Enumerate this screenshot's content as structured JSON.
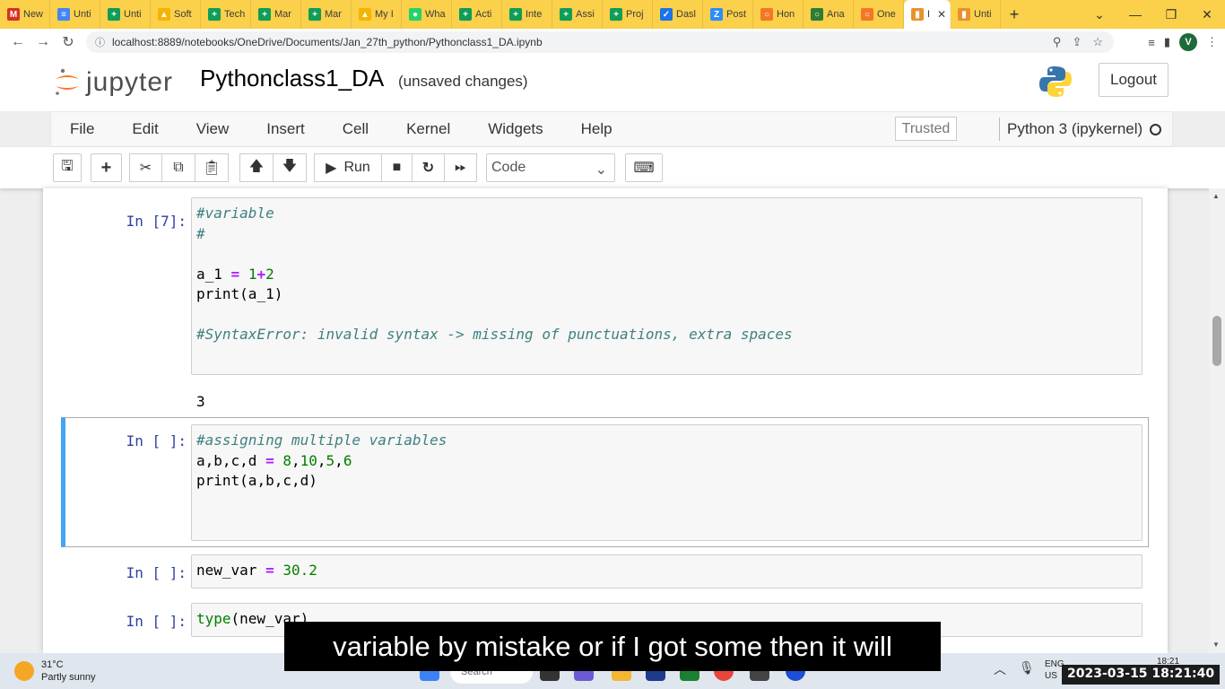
{
  "browser": {
    "tabs": [
      {
        "label": "New",
        "color": "#d93025",
        "glyph": "M"
      },
      {
        "label": "Unti",
        "color": "#4285f4",
        "glyph": "≡"
      },
      {
        "label": "Unti",
        "color": "#0f9d58",
        "glyph": "+"
      },
      {
        "label": "Soft",
        "color": "#f4b400",
        "glyph": "▲"
      },
      {
        "label": "Tech",
        "color": "#0f9d58",
        "glyph": "+"
      },
      {
        "label": "Mar",
        "color": "#0f9d58",
        "glyph": "+"
      },
      {
        "label": "Mar",
        "color": "#0f9d58",
        "glyph": "+"
      },
      {
        "label": "My I",
        "color": "#f4b400",
        "glyph": "▲"
      },
      {
        "label": "Wha",
        "color": "#25d366",
        "glyph": "●"
      },
      {
        "label": "Acti",
        "color": "#0f9d58",
        "glyph": "+"
      },
      {
        "label": "Inte",
        "color": "#0f9d58",
        "glyph": "+"
      },
      {
        "label": "Assi",
        "color": "#0f9d58",
        "glyph": "+"
      },
      {
        "label": "Proj",
        "color": "#0f9d58",
        "glyph": "+"
      },
      {
        "label": "Dasl",
        "color": "#1a73e8",
        "glyph": "✓"
      },
      {
        "label": "Post",
        "color": "#2d8cff",
        "glyph": "Z"
      },
      {
        "label": "Hon",
        "color": "#f37726",
        "glyph": "○"
      },
      {
        "label": "Ana",
        "color": "#2e7d32",
        "glyph": "○"
      },
      {
        "label": "One",
        "color": "#f37726",
        "glyph": "○"
      },
      {
        "label": "I",
        "color": "#e8912d",
        "glyph": "▮",
        "active": true
      },
      {
        "label": "Unti",
        "color": "#e8912d",
        "glyph": "▮"
      }
    ],
    "new_tab": "+",
    "window_controls": [
      "⌄",
      "—",
      "❐",
      "✕"
    ],
    "url": "localhost:8889/notebooks/OneDrive/Documents/Jan_27th_python/Pythonclass1_DA.ipynb",
    "avatar_letter": "V"
  },
  "jupyter": {
    "logo_text": "jupyter",
    "notebook_title": "Pythonclass1_DA",
    "save_status": "(unsaved changes)",
    "logout_label": "Logout",
    "menu": [
      "File",
      "Edit",
      "View",
      "Insert",
      "Cell",
      "Kernel",
      "Widgets",
      "Help"
    ],
    "trusted_label": "Trusted",
    "kernel_name": "Python 3 (ipykernel)",
    "toolbar": {
      "run_label": "Run",
      "cell_type": "Code"
    }
  },
  "cells": [
    {
      "prompt": "In [7]:",
      "lines": [
        [
          {
            "t": "#variable",
            "c": "comment"
          }
        ],
        [
          {
            "t": "#",
            "c": "comment"
          }
        ],
        [
          {
            "t": "",
            "c": ""
          }
        ],
        [
          {
            "t": "a_1 ",
            "c": ""
          },
          {
            "t": "=",
            "c": "op"
          },
          {
            "t": " ",
            "c": ""
          },
          {
            "t": "1",
            "c": "num"
          },
          {
            "t": "+",
            "c": "op"
          },
          {
            "t": "2",
            "c": "num"
          }
        ],
        [
          {
            "t": "print",
            "c": ""
          },
          {
            "t": "(a_1)",
            "c": ""
          }
        ],
        [
          {
            "t": "",
            "c": ""
          }
        ],
        [
          {
            "t": "#SyntaxError: invalid syntax -> missing of punctuations, extra spaces",
            "c": "comment"
          }
        ]
      ],
      "output": "3"
    },
    {
      "prompt": "In [ ]:",
      "lines": [
        [
          {
            "t": "#assigning multiple variables",
            "c": "comment"
          }
        ],
        [
          {
            "t": "a,b,c,d ",
            "c": ""
          },
          {
            "t": "=",
            "c": "op"
          },
          {
            "t": " ",
            "c": ""
          },
          {
            "t": "8",
            "c": "num"
          },
          {
            "t": ",",
            "c": ""
          },
          {
            "t": "10",
            "c": "num"
          },
          {
            "t": ",",
            "c": ""
          },
          {
            "t": "5",
            "c": "num"
          },
          {
            "t": ",",
            "c": ""
          },
          {
            "t": "6",
            "c": "num"
          }
        ],
        [
          {
            "t": "print",
            "c": ""
          },
          {
            "t": "(a,b,c,d)",
            "c": ""
          }
        ]
      ]
    },
    {
      "prompt": "In [ ]:",
      "lines": [
        [
          {
            "t": "new_var ",
            "c": ""
          },
          {
            "t": "=",
            "c": "op"
          },
          {
            "t": " ",
            "c": ""
          },
          {
            "t": "30.2",
            "c": "num"
          }
        ]
      ]
    },
    {
      "prompt": "In [ ]:",
      "lines": [
        [
          {
            "t": "type",
            "c": "builtin"
          },
          {
            "t": "(new_var)",
            "c": ""
          }
        ]
      ]
    }
  ],
  "taskbar": {
    "temperature": "31°C",
    "weather": "Partly sunny",
    "search_placeholder": "Search",
    "lang_line1": "ENG",
    "lang_line2": "US",
    "time": "18:21"
  },
  "overlay": {
    "subtitle": "variable by mistake or if I got some then it will",
    "datestamp": "2023-03-15  18:21:40"
  }
}
